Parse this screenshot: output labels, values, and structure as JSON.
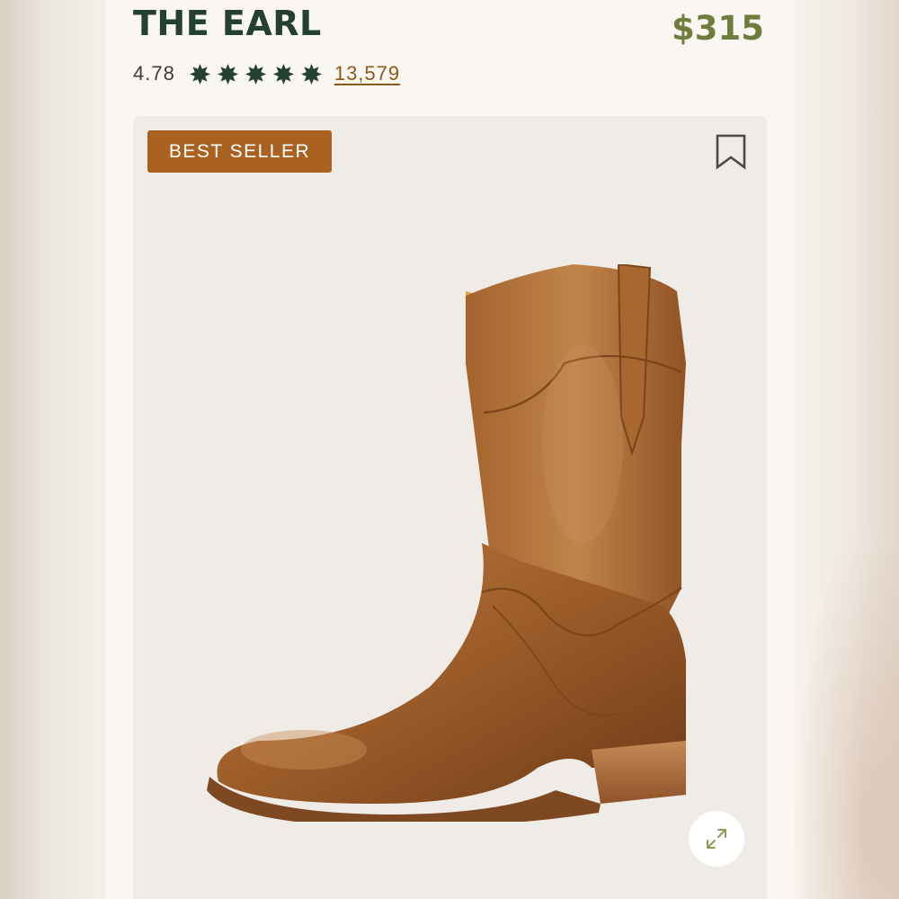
{
  "product": {
    "title": "THE EARL",
    "price": "$315",
    "rating": "4.78",
    "stars": 5,
    "review_count": "13,579",
    "badge": "BEST SELLER"
  },
  "icons": {
    "star": "star-icon",
    "bookmark": "bookmark-icon",
    "expand": "expand-icon"
  },
  "colors": {
    "title": "#24402f",
    "price": "#6f7d3c",
    "badge_bg": "#a96221",
    "link": "#8a5a14",
    "card_bg": "#faf7f2",
    "image_bg": "#efebe6"
  }
}
